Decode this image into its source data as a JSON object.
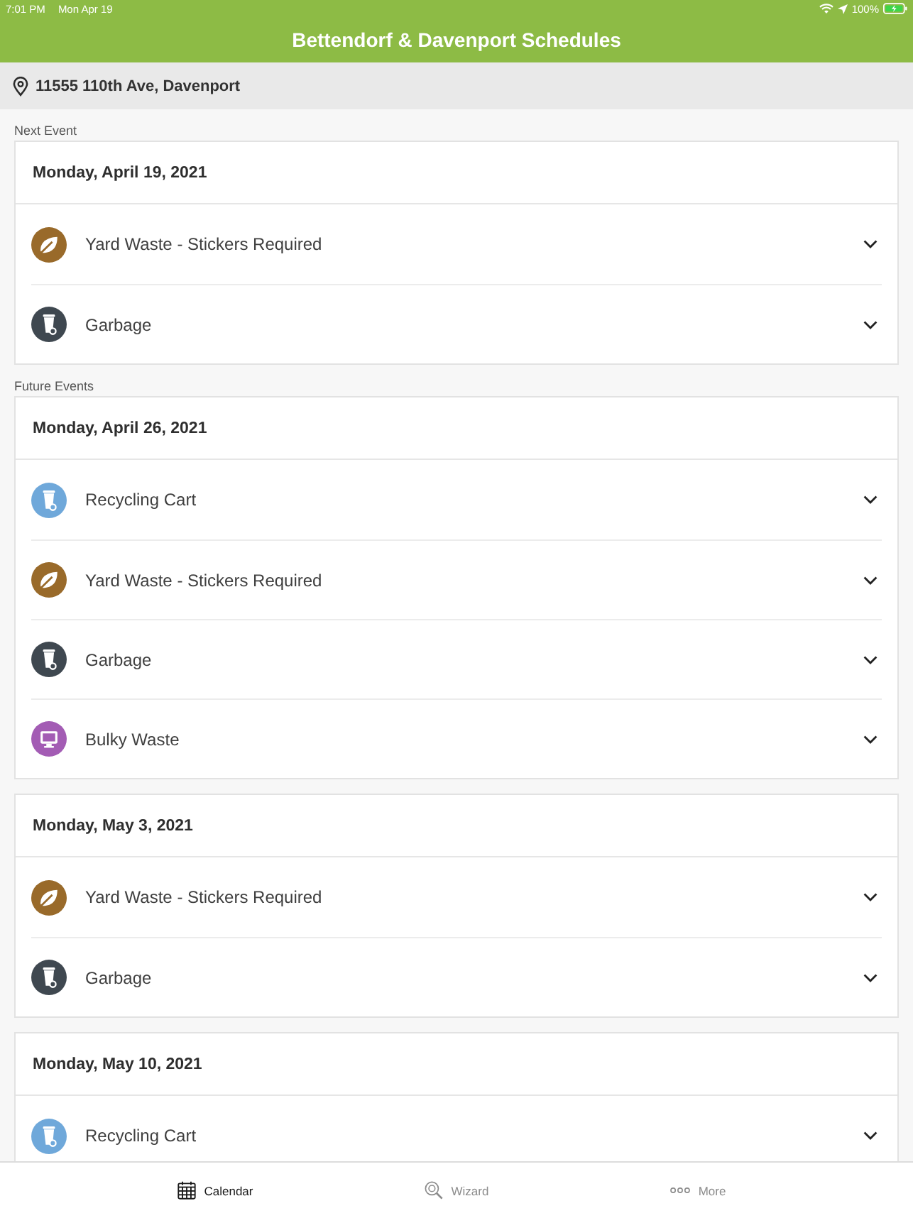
{
  "status_bar": {
    "time": "7:01 PM",
    "date": "Mon Apr 19",
    "battery": "100%"
  },
  "header": {
    "title": "Bettendorf & Davenport Schedules"
  },
  "location": {
    "address": "11555 110th Ave, Davenport"
  },
  "sections": [
    {
      "label": "Next Event",
      "days": [
        {
          "date": "Monday, April 19, 2021",
          "events": [
            {
              "name": "Yard Waste - Stickers Required",
              "kind": "leaf",
              "color": "#996a2a",
              "expanded": false
            },
            {
              "name": "Garbage",
              "kind": "cart",
              "color": "#3f4850",
              "expanded": false
            }
          ]
        }
      ]
    },
    {
      "label": "Future Events",
      "days": [
        {
          "date": "Monday, April 26, 2021",
          "events": [
            {
              "name": "Recycling Cart",
              "kind": "cart",
              "color": "#6fa8da",
              "expanded": false
            },
            {
              "name": "Yard Waste - Stickers Required",
              "kind": "leaf",
              "color": "#996a2a",
              "expanded": false
            },
            {
              "name": "Garbage",
              "kind": "cart",
              "color": "#3f4850",
              "expanded": false
            },
            {
              "name": "Bulky Waste",
              "kind": "screen",
              "color": "#a35cb4",
              "expanded": false
            }
          ]
        },
        {
          "date": "Monday, May 3, 2021",
          "events": [
            {
              "name": "Yard Waste - Stickers Required",
              "kind": "leaf",
              "color": "#996a2a",
              "expanded": false
            },
            {
              "name": "Garbage",
              "kind": "cart",
              "color": "#3f4850",
              "expanded": false
            }
          ]
        },
        {
          "date": "Monday, May 10, 2021",
          "events": [
            {
              "name": "Recycling Cart",
              "kind": "cart",
              "color": "#6fa8da",
              "expanded": false
            }
          ]
        }
      ]
    }
  ],
  "tab_bar": [
    {
      "label": "Calendar",
      "kind": "calendar",
      "selected": true
    },
    {
      "label": "Wizard",
      "kind": "wizard",
      "selected": false
    },
    {
      "label": "More",
      "kind": "more",
      "selected": false
    }
  ]
}
